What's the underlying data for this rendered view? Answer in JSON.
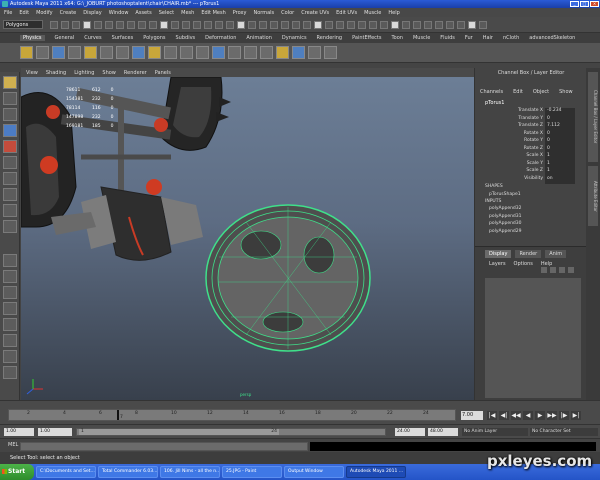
{
  "window": {
    "title": "Autodesk Maya 2011 x64: G:\\_JOBURT photoshoptalent\\chair\\CHAIR.mb* --- pTorus1",
    "minimize": "_",
    "maximize": "□",
    "close": "×"
  },
  "menu_bar": [
    "File",
    "Edit",
    "Modify",
    "Create",
    "Display",
    "Window",
    "Assets",
    "Select",
    "Mesh",
    "Edit Mesh",
    "Proxy",
    "Normals",
    "Color",
    "Create UVs",
    "Edit UVs",
    "Muscle",
    "Help"
  ],
  "status_line": {
    "mode": "Polygons"
  },
  "shelf_tabs": [
    {
      "label": "Physics",
      "active": true
    },
    {
      "label": "General"
    },
    {
      "label": "Curves"
    },
    {
      "label": "Surfaces"
    },
    {
      "label": "Polygons"
    },
    {
      "label": "Subdivs"
    },
    {
      "label": "Deformation"
    },
    {
      "label": "Animation"
    },
    {
      "label": "Dynamics"
    },
    {
      "label": "Rendering"
    },
    {
      "label": "PaintEffects"
    },
    {
      "label": "Toon"
    },
    {
      "label": "Muscle"
    },
    {
      "label": "Fluids"
    },
    {
      "label": "Fur"
    },
    {
      "label": "Hair"
    },
    {
      "label": "nCloth"
    },
    {
      "label": "advancedSkeleton"
    }
  ],
  "viewport_menu": [
    "View",
    "Shading",
    "Lighting",
    "Show",
    "Renderer",
    "Panels"
  ],
  "poly_stats": [
    {
      "a": "78611",
      "b": "612",
      "c": "0"
    },
    {
      "a": "154381",
      "b": "232",
      "c": "0"
    },
    {
      "a": "78114",
      "b": "116",
      "c": "0"
    },
    {
      "a": "147898",
      "b": "232",
      "c": "0"
    },
    {
      "a": "169181",
      "b": "185",
      "c": "0"
    }
  ],
  "viewport_label": "persp",
  "channel_box": {
    "header": "Channel Box / Layer Editor",
    "menu": [
      "Channels",
      "Edit",
      "Object",
      "Show"
    ],
    "object_name": "pTorus1",
    "attributes": [
      {
        "label": "Translate X",
        "value": "-0.234"
      },
      {
        "label": "Translate Y",
        "value": "0"
      },
      {
        "label": "Translate Z",
        "value": "7.112"
      },
      {
        "label": "Rotate X",
        "value": "0"
      },
      {
        "label": "Rotate Y",
        "value": "0"
      },
      {
        "label": "Rotate Z",
        "value": "0"
      },
      {
        "label": "Scale X",
        "value": "1"
      },
      {
        "label": "Scale Y",
        "value": "1"
      },
      {
        "label": "Scale Z",
        "value": "1"
      },
      {
        "label": "Visibility",
        "value": "on"
      }
    ],
    "shapes_label": "SHAPES",
    "shape_name": "pTorusShape1",
    "inputs_label": "INPUTS",
    "inputs": [
      "polyAppend32",
      "polyAppend31",
      "polyAppend30",
      "polyAppend29"
    ]
  },
  "layer_editor": {
    "tabs": [
      {
        "label": "Display",
        "active": true
      },
      {
        "label": "Render"
      },
      {
        "label": "Anim"
      }
    ],
    "menu": [
      "Layers",
      "Options",
      "Help"
    ]
  },
  "side_tabs": [
    "Channel Box / Layer Editor",
    "Attribute Editor"
  ],
  "time_slider": {
    "ticks": [
      "2",
      "4",
      "6",
      "8",
      "10",
      "12",
      "14",
      "16",
      "18",
      "20",
      "22",
      "24"
    ],
    "current_frame_marker": "7",
    "current_frame": "7.00",
    "playback": [
      "|◀",
      "◀|",
      "◀◀",
      "◀",
      "▶",
      "▶▶",
      "|▶",
      "▶|"
    ]
  },
  "range_slider": {
    "start": "1.00",
    "start2": "1.00",
    "range_start_marker": "1",
    "range_end_marker": "24",
    "end": "24.00",
    "end2": "48.00",
    "anim_layer": "No Anim Layer",
    "character_set": "No Character Set"
  },
  "command_line": {
    "label": "MEL"
  },
  "help_line": "Select Tool: select an object",
  "taskbar": {
    "start": "Start",
    "items": [
      {
        "label": "C:\\Documents and Set..."
      },
      {
        "label": "Total Commander 6.03..."
      },
      {
        "label": "106. Jill Nims - all the n..."
      },
      {
        "label": "25.JPG - Paint"
      },
      {
        "label": "Output Window"
      },
      {
        "label": "Autodesk Maya 2011 ...",
        "active": true
      }
    ]
  },
  "watermark": "pxleyes.com",
  "colors": {
    "title_bar": "#2a5bd7",
    "torus_wire": "#3fe08a",
    "viewport_top": "#6c7e96",
    "viewport_bottom": "#38404c"
  }
}
